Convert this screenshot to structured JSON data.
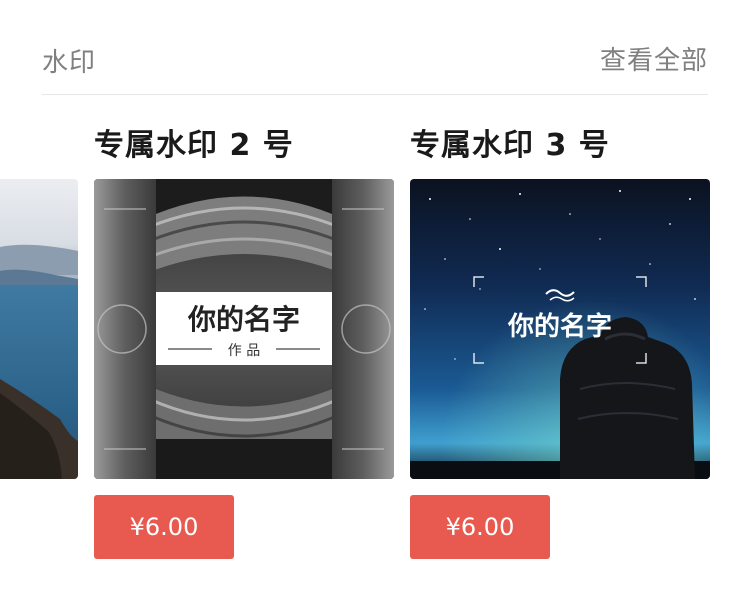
{
  "section": {
    "title": "水印",
    "see_all": "查看全部"
  },
  "cards": [
    {
      "title": "专属水印 2 号",
      "image_text_main": "你的名字",
      "image_text_sub": "作 品",
      "price": "¥6.00"
    },
    {
      "title": "专属水印 3 号",
      "image_text_main": "你的名字",
      "price": "¥6.00"
    }
  ],
  "colors": {
    "price_button": "#e85a4f",
    "muted_text": "#808080",
    "title_text": "#1a1a1a"
  }
}
